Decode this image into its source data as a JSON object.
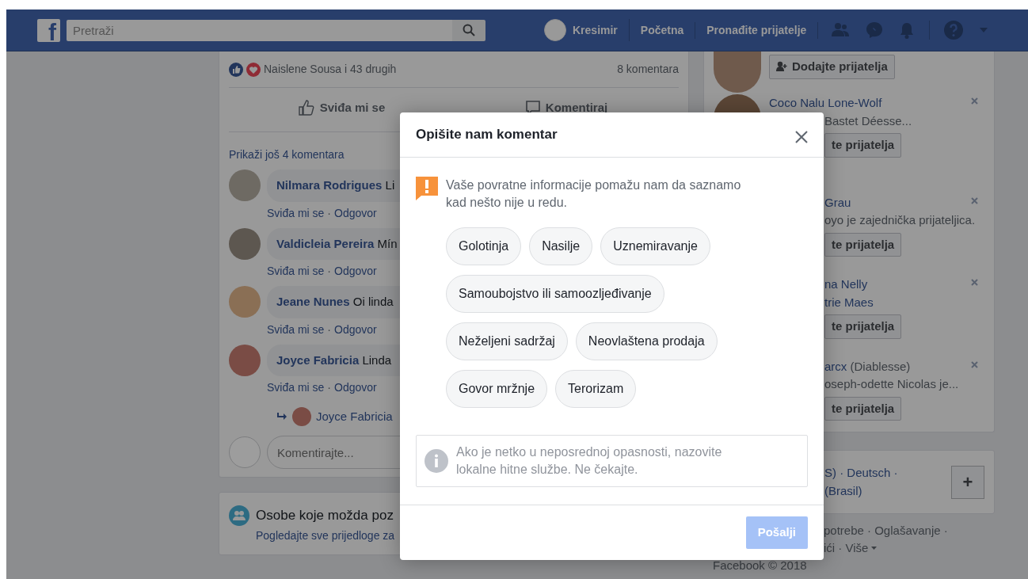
{
  "top_bar": {
    "logo": "f",
    "search": {
      "placeholder": "Pretraži"
    },
    "profile_name": "Kresimir",
    "nav_links": [
      "Početna",
      "Pronađite prijatelje"
    ]
  },
  "post": {
    "reactions_text": "Naislene Sousa i 43 drugih",
    "comment_count": "8 komentara",
    "actions": [
      "Sviđa mi se",
      "Komentiraj"
    ],
    "more_comments": "Prikaži još 4 komentara",
    "comments": [
      {
        "author": "Nilmara Rodrigues",
        "text": "Li",
        "like": "Sviđa mi se",
        "separator": "·",
        "reply": "Odgovor"
      },
      {
        "author": "Valdicleia Pereira",
        "text": "Mín",
        "like": "Sviđa mi se",
        "separator": "·",
        "reply": "Odgovor"
      },
      {
        "author": "Jeane Nunes",
        "text": "Oi linda",
        "like": "Sviđa mi se",
        "separator": "·",
        "reply": "Odgovor"
      },
      {
        "author": "Joyce Fabricia",
        "text": "Linda",
        "like": "Sviđa mi se",
        "separator": "·",
        "reply": "Odgovor"
      }
    ],
    "reply": {
      "author": "Joyce Fabricia"
    },
    "comment_input": {
      "placeholder": "Komentirajte..."
    }
  },
  "people_card": {
    "title": "Osobe koje možda poz",
    "link": "Pogledajte sve prijedloge za"
  },
  "suggestions": [
    {
      "avatar_visible": true,
      "button": "Dodajte prijatelja",
      "button_covered": false,
      "dismissible": false
    },
    {
      "avatar_visible": true,
      "name_lines": [
        "Coco Nalu Lone-Wolf"
      ],
      "name_covered": false,
      "detail": "Bastet Déesse...",
      "button": "te prijatelja",
      "button_covered": true,
      "dismissible": true
    },
    {
      "avatar_visible": false,
      "name_lines": [
        "Grau"
      ],
      "name_covered": true,
      "detail": "oyo je zajednička prijateljica.",
      "button": "te prijatelja",
      "button_covered": true,
      "dismissible": true
    },
    {
      "avatar_visible": false,
      "name_lines": [
        "na Nelly",
        "trie Maes"
      ],
      "name_covered": true,
      "button": "te prijatelja",
      "button_covered": true,
      "dismissible": true
    },
    {
      "avatar_visible": false,
      "name_lines": [
        "arcx"
      ],
      "alias": "(Diablesse)",
      "name_covered": true,
      "detail": "oseph-odette Nicolas je...",
      "button": "te prijatelja",
      "button_covered": true,
      "dismissible": true
    }
  ],
  "languages": {
    "lines": [
      "S) · Deutsch ·",
      "(Brasil)"
    ],
    "add_button": "+"
  },
  "footer": {
    "lines": [
      "potrebe · Oglašavanje ·",
      "ići · Više"
    ],
    "copyright": "Facebook © 2018"
  },
  "dialog": {
    "title": "Opišite nam komentar",
    "intro": "Vaše povratne informacije pomažu nam da saznamo kad nešto nije u redu.",
    "options": [
      {
        "label": "Golotinja",
        "selected": false
      },
      {
        "label": "Nasilje",
        "selected": false
      },
      {
        "label": "Uznemiravanje",
        "selected": false
      },
      {
        "label": "Samoubojstvo ili samoozljeđivanje",
        "selected": false
      },
      {
        "label": "Neželjeni sadržaj",
        "selected": false
      },
      {
        "label": "Neovlaštena prodaja",
        "selected": false
      },
      {
        "label": "Govor mržnje",
        "selected": false
      },
      {
        "label": "Terorizam",
        "selected": false
      }
    ],
    "notice": "Ako je netko u neposrednoj opasnosti, nazovite lokalne hitne službe. Ne čekajte.",
    "submit": {
      "label": "Pošalji",
      "disabled": true
    }
  }
}
